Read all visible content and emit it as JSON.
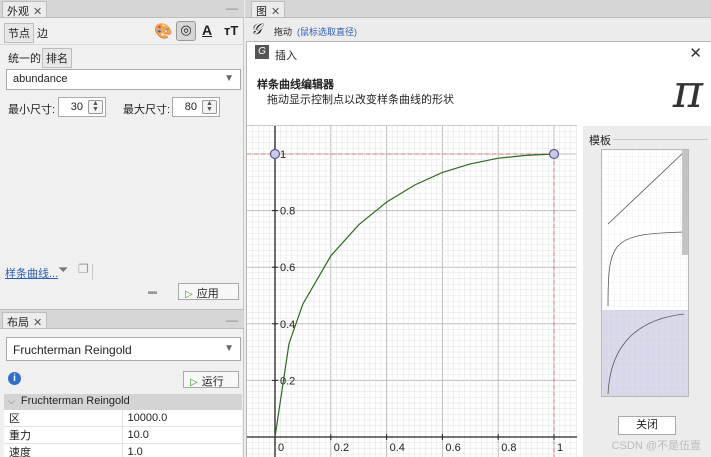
{
  "appearance": {
    "tab_label": "外观",
    "node_tab": "节点",
    "edge_tab": "边",
    "unique_label": "统一的",
    "ranking_label": "排名",
    "attribute_combo": "abundance",
    "min_size_label": "最小尺寸:",
    "min_size_value": "30",
    "max_size_label": "最大尺寸:",
    "max_size_value": "80",
    "spline_link": "样条曲线...",
    "apply_label": "应用"
  },
  "layout": {
    "tab_label": "布局",
    "algorithm_combo": "Fruchterman Reingold",
    "run_label": "运行",
    "section_header": "Fruchterman Reingold",
    "properties": [
      {
        "key": "区",
        "value": "10000.0"
      },
      {
        "key": "重力",
        "value": "10.0"
      },
      {
        "key": "速度",
        "value": "1.0"
      }
    ]
  },
  "graph_window": {
    "tab_label": "图",
    "drag_tool": "拖动",
    "drag_hint": "(鼠标选取直径)"
  },
  "dialog": {
    "title": "插入",
    "heading": "样条曲线编辑器",
    "subheading": "拖动显示控制点以改变样条曲线的形状",
    "pi_symbol": "π",
    "templates_label": "模板",
    "close_label": "关闭"
  },
  "chart_data": {
    "type": "line",
    "x_ticks": [
      "0",
      "0.2",
      "0.4",
      "0.6",
      "0.8",
      "1"
    ],
    "y_ticks": [
      "0.2",
      "0.4",
      "0.6",
      "0.8",
      "1"
    ],
    "xlim": [
      0,
      1
    ],
    "ylim": [
      0,
      1
    ],
    "grid": true,
    "series": [
      {
        "values": [
          [
            0,
            0
          ],
          [
            0.05,
            0.33
          ],
          [
            0.1,
            0.47
          ],
          [
            0.2,
            0.64
          ],
          [
            0.3,
            0.75
          ],
          [
            0.4,
            0.83
          ],
          [
            0.5,
            0.89
          ],
          [
            0.6,
            0.935
          ],
          [
            0.7,
            0.965
          ],
          [
            0.8,
            0.985
          ],
          [
            0.9,
            0.995
          ],
          [
            1,
            1
          ]
        ]
      }
    ],
    "control_points": [
      [
        0,
        1
      ],
      [
        1,
        1
      ]
    ],
    "line_color": "#2e6b1f",
    "guide_color": "#e06060"
  },
  "watermark": "CSDN @不是伍壹"
}
